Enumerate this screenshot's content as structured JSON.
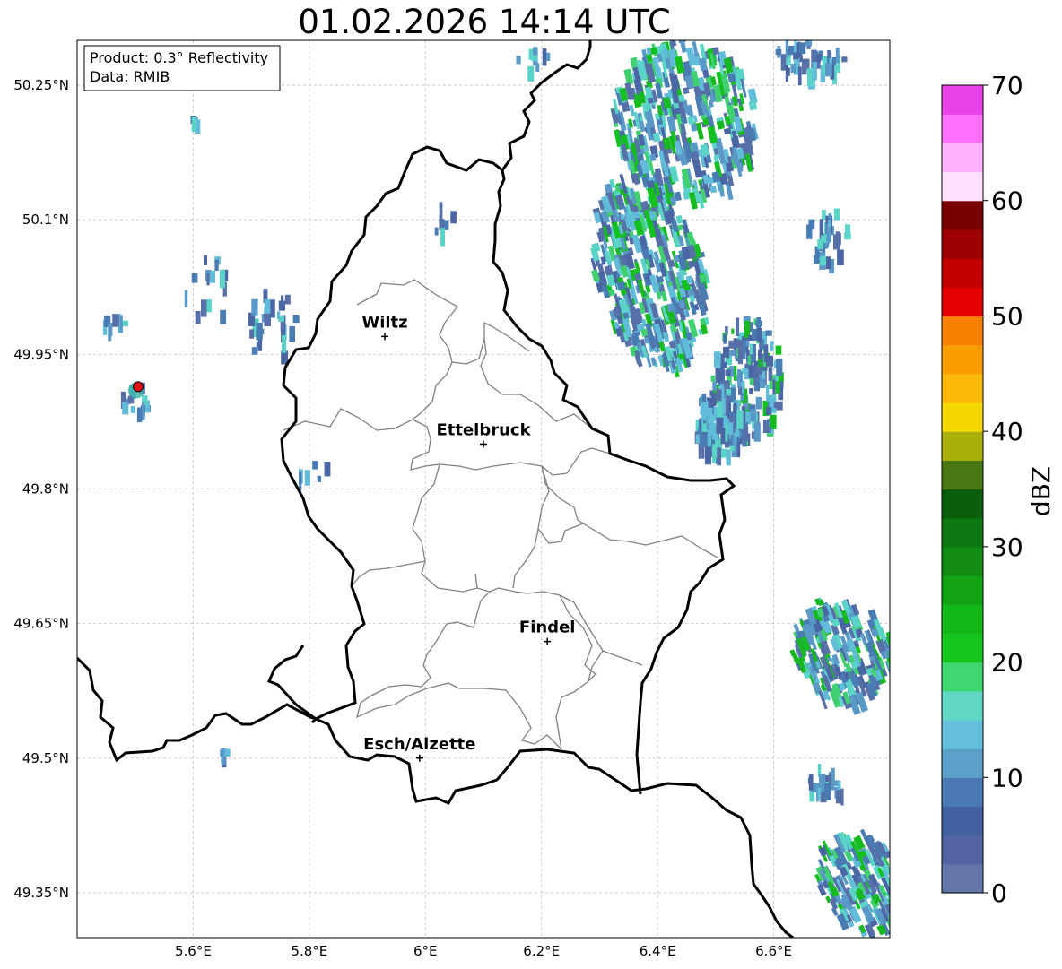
{
  "title": "01.02.2026 14:14 UTC",
  "info_box": {
    "product": "Product: 0.3° Reflectivity",
    "data": "Data: RMIB"
  },
  "map": {
    "lon_range": [
      5.4,
      6.8
    ],
    "lat_range": [
      49.3,
      50.3
    ],
    "lon_ticks": [
      "5.6°E",
      "5.8°E",
      "6°E",
      "6.2°E",
      "6.4°E",
      "6.6°E"
    ],
    "lat_ticks": [
      "50.25°N",
      "50.1°N",
      "49.95°N",
      "49.8°N",
      "49.65°N",
      "49.5°N",
      "49.35°N"
    ],
    "gridlines": true,
    "cities": [
      {
        "name": "Wiltz",
        "lon": 5.93,
        "lat": 49.97
      },
      {
        "name": "Ettelbruck",
        "lon": 6.1,
        "lat": 49.85
      },
      {
        "name": "Findel",
        "lon": 6.21,
        "lat": 49.63
      },
      {
        "name": "Esch/Alzette",
        "lon": 5.99,
        "lat": 49.5
      }
    ],
    "radar_site": {
      "lon": 5.505,
      "lat": 49.914
    },
    "border_color": "#000000",
    "canton_color": "#808080"
  },
  "colorbar": {
    "label": "dBZ",
    "ticks": [
      "0",
      "10",
      "20",
      "30",
      "40",
      "50",
      "60",
      "70"
    ],
    "min": 0,
    "max": 70,
    "colors": [
      "#6476a8",
      "#5464a2",
      "#4361a0",
      "#4a78b2",
      "#5aa0c8",
      "#64c0dc",
      "#60d8c4",
      "#40d670",
      "#14c61e",
      "#12b818",
      "#12a414",
      "#128c14",
      "#0e7812",
      "#0a5e0c",
      "#4a7814",
      "#aab00a",
      "#f6d800",
      "#fab808",
      "#fa9e00",
      "#fa8000",
      "#e40000",
      "#c20000",
      "#9c0000",
      "#780000",
      "#ffe0ff",
      "#ffb0ff",
      "#ff70ff",
      "#e842e8"
    ]
  }
}
